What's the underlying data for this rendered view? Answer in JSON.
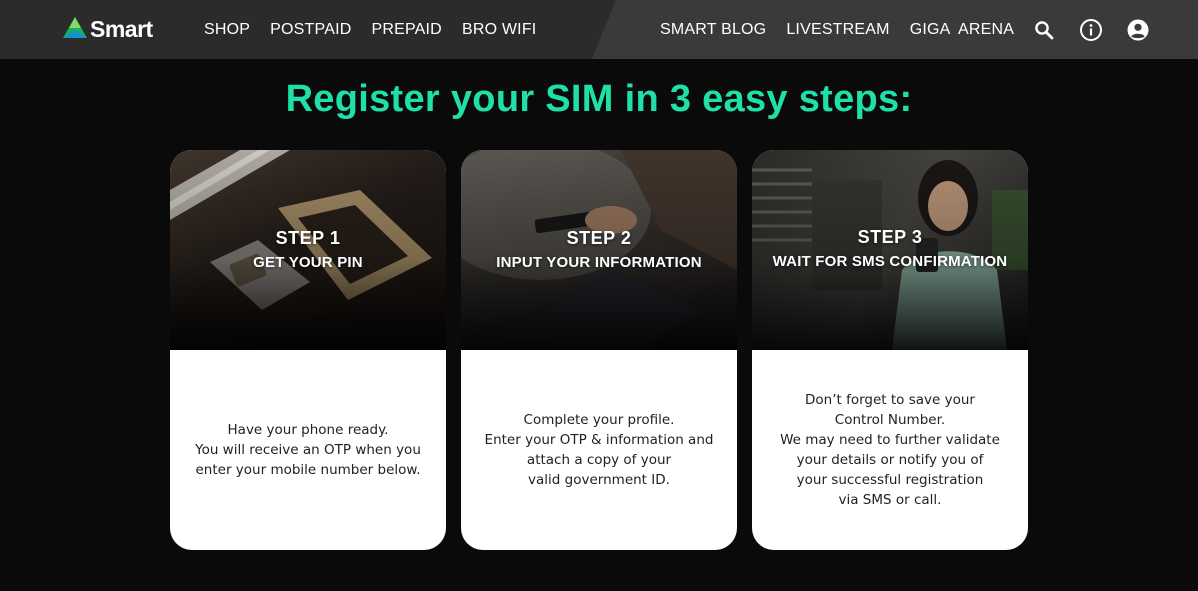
{
  "brand": {
    "name": "Smart",
    "accent": "#1fe0a8"
  },
  "nav": {
    "left_links": [
      "SHOP",
      "POSTPAID",
      "PREPAID",
      "BRO WIFI"
    ],
    "right_links": [
      "SMART BLOG",
      "LIVESTREAM",
      "GIGA  ARENA"
    ],
    "icons": [
      "search-icon",
      "info-icon",
      "account-icon"
    ]
  },
  "heading": "Register your SIM in 3 easy steps:",
  "steps": [
    {
      "number": "STEP 1",
      "title": "GET YOUR PIN",
      "image": "sim-card-tray-photo",
      "lines": [
        "Have your phone ready.",
        "You will receive an OTP when you",
        "enter your mobile number below."
      ]
    },
    {
      "number": "STEP 2",
      "title": "INPUT YOUR INFORMATION",
      "image": "hands-holding-phone-photo",
      "lines": [
        "Complete your profile.",
        "Enter your OTP & information and",
        "attach a copy of your",
        "valid government ID."
      ]
    },
    {
      "number": "STEP 3",
      "title": "WAIT FOR SMS CONFIRMATION",
      "image": "woman-smiling-at-phone-photo",
      "lines": [
        "Don’t forget to save your",
        "Control Number.",
        "We may need to further validate",
        "your details or notify you of",
        "your successful registration",
        "via SMS or call."
      ]
    }
  ]
}
